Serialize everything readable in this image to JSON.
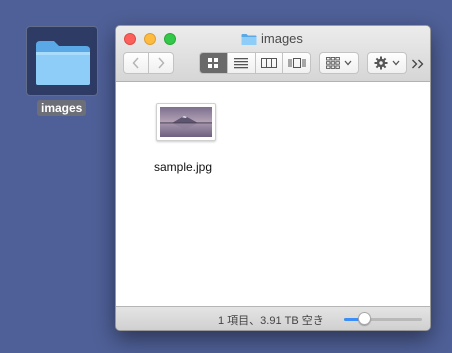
{
  "desktop": {
    "folder_label": "images",
    "folder_icon": "folder-icon"
  },
  "window": {
    "title": "images",
    "title_icon": "folder-icon",
    "toolbar": {
      "back_icon": "chevron-left-icon",
      "forward_icon": "chevron-right-icon",
      "view_modes": [
        "icon-view",
        "list-view",
        "column-view",
        "cover-flow-view"
      ],
      "active_view": "icon-view",
      "arrange_icon": "arrange-grid-icon",
      "action_icon": "gear-icon",
      "more_icon": "double-chevron-right-icon"
    },
    "files": [
      {
        "name": "sample.jpg",
        "thumbnail": "mountain-lake-thumbnail"
      }
    ],
    "status": {
      "text": "1 項目、3.91 TB 空き",
      "zoom_level": 0.26
    }
  },
  "colors": {
    "desktop_bg": "#4f6098",
    "accent": "#3b8ef7",
    "folder_blue": "#7cc2f5"
  }
}
